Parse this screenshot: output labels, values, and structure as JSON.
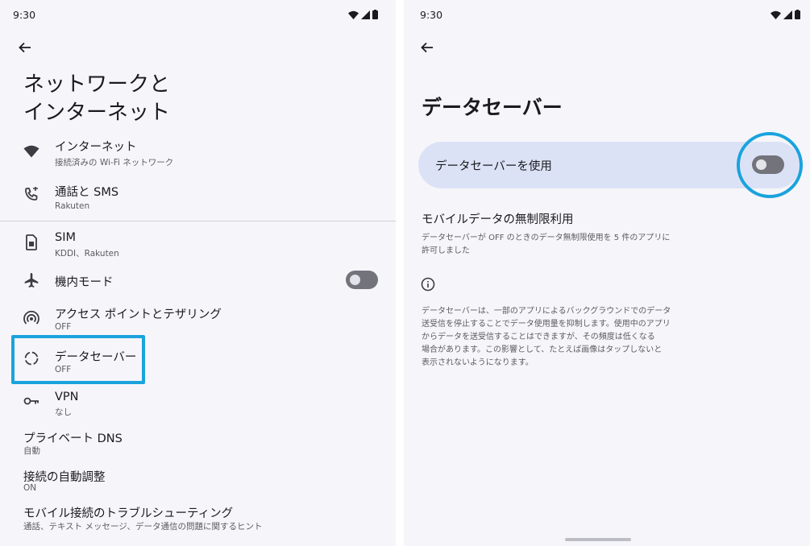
{
  "left": {
    "status": {
      "time": "9:30"
    },
    "title_line1": "ネットワークと",
    "title_line2": "インターネット",
    "items": [
      {
        "title": "インターネット",
        "subtitle": "接続済みの Wi-Fi ネットワーク",
        "icon": "wifi-icon"
      },
      {
        "title": "通話と SMS",
        "subtitle": "Rakuten",
        "icon": "phone-icon"
      },
      {
        "title": "SIM",
        "subtitle": "KDDI、Rakuten",
        "icon": "sim-icon"
      },
      {
        "title": "機内モード",
        "icon": "airplane-icon",
        "toggle": false
      },
      {
        "title": "アクセス ポイントとテザリング",
        "subtitle": "OFF",
        "icon": "hotspot-icon"
      },
      {
        "title": "データセーバー",
        "subtitle": "OFF",
        "icon": "data-saver-icon"
      },
      {
        "title": "VPN",
        "subtitle": "なし",
        "icon": "key-icon"
      },
      {
        "title": "プライベート DNS",
        "subtitle": "自動"
      },
      {
        "title": "接続の自動調整",
        "subtitle": "ON"
      },
      {
        "title": "モバイル接続のトラブルシューティング",
        "subtitle": "通話、テキスト メッセージ、データ通信の問題に関するヒント"
      }
    ]
  },
  "right": {
    "status": {
      "time": "9:30"
    },
    "title": "データセーバー",
    "main_switch": {
      "label": "データセーバーを使用",
      "on": false
    },
    "unrestricted": {
      "title": "モバイルデータの無制限利用",
      "line1": "データセーバーが OFF のときのデータ無制限使用を 5 件のアプリに",
      "line2": "許可しました"
    },
    "footer": [
      "データセーバーは、一部のアプリによるバックグラウンドでのデータ",
      "送受信を停止することでデータ使用量を抑制します。使用中のアプリ",
      "からデータを送受信することはできますが、その頻度は低くなる",
      "場合があります。この影響として、たとえば画像はタップしないと",
      "表示されないようになります。"
    ]
  },
  "colors": {
    "highlight": "#1aa3dd",
    "switch_bg": "#dce2f6",
    "screen_bg": "#f6f6fa"
  }
}
